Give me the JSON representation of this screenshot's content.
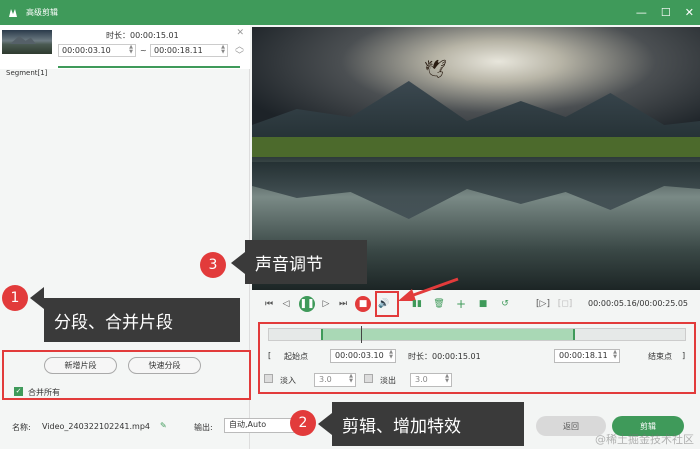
{
  "window": {
    "title": "高级剪辑",
    "controls": [
      "—",
      "☐",
      "✕"
    ]
  },
  "segment": {
    "duration_label": "时长：",
    "duration": "00:00:15.01",
    "start": "00:00:03.10",
    "dash": "~",
    "end": "00:00:18.11",
    "label": "Segment[1]"
  },
  "callouts": {
    "one": {
      "num": "1",
      "text": "分段、合并片段"
    },
    "two": {
      "num": "2",
      "text": "剪辑、增加特效"
    },
    "three": {
      "num": "3",
      "text": "声音调节"
    }
  },
  "left_panel": {
    "new_segment": "新增片段",
    "quick_split": "快速分段",
    "merge_all": "合并所有"
  },
  "player": {
    "timecode": "00:00:05.16/00:00:25.05"
  },
  "edit": {
    "start_point": "起始点",
    "start_time": "00:00:03.10",
    "duration_label": "时长：",
    "duration": "00:00:15.01",
    "end_time": "00:00:18.11",
    "end_point": "结束点",
    "fade_in": "淡入",
    "fade_in_value": "3.0",
    "fade_out": "淡出",
    "fade_out_value": "3.0"
  },
  "footer": {
    "name_label": "名称:",
    "filename": "Video_240322102241.mp4",
    "output_label": "输出:",
    "output_value": "自动,Auto",
    "back": "返回",
    "cut": "剪辑",
    "watermark": "@稀土掘金技术社区"
  }
}
